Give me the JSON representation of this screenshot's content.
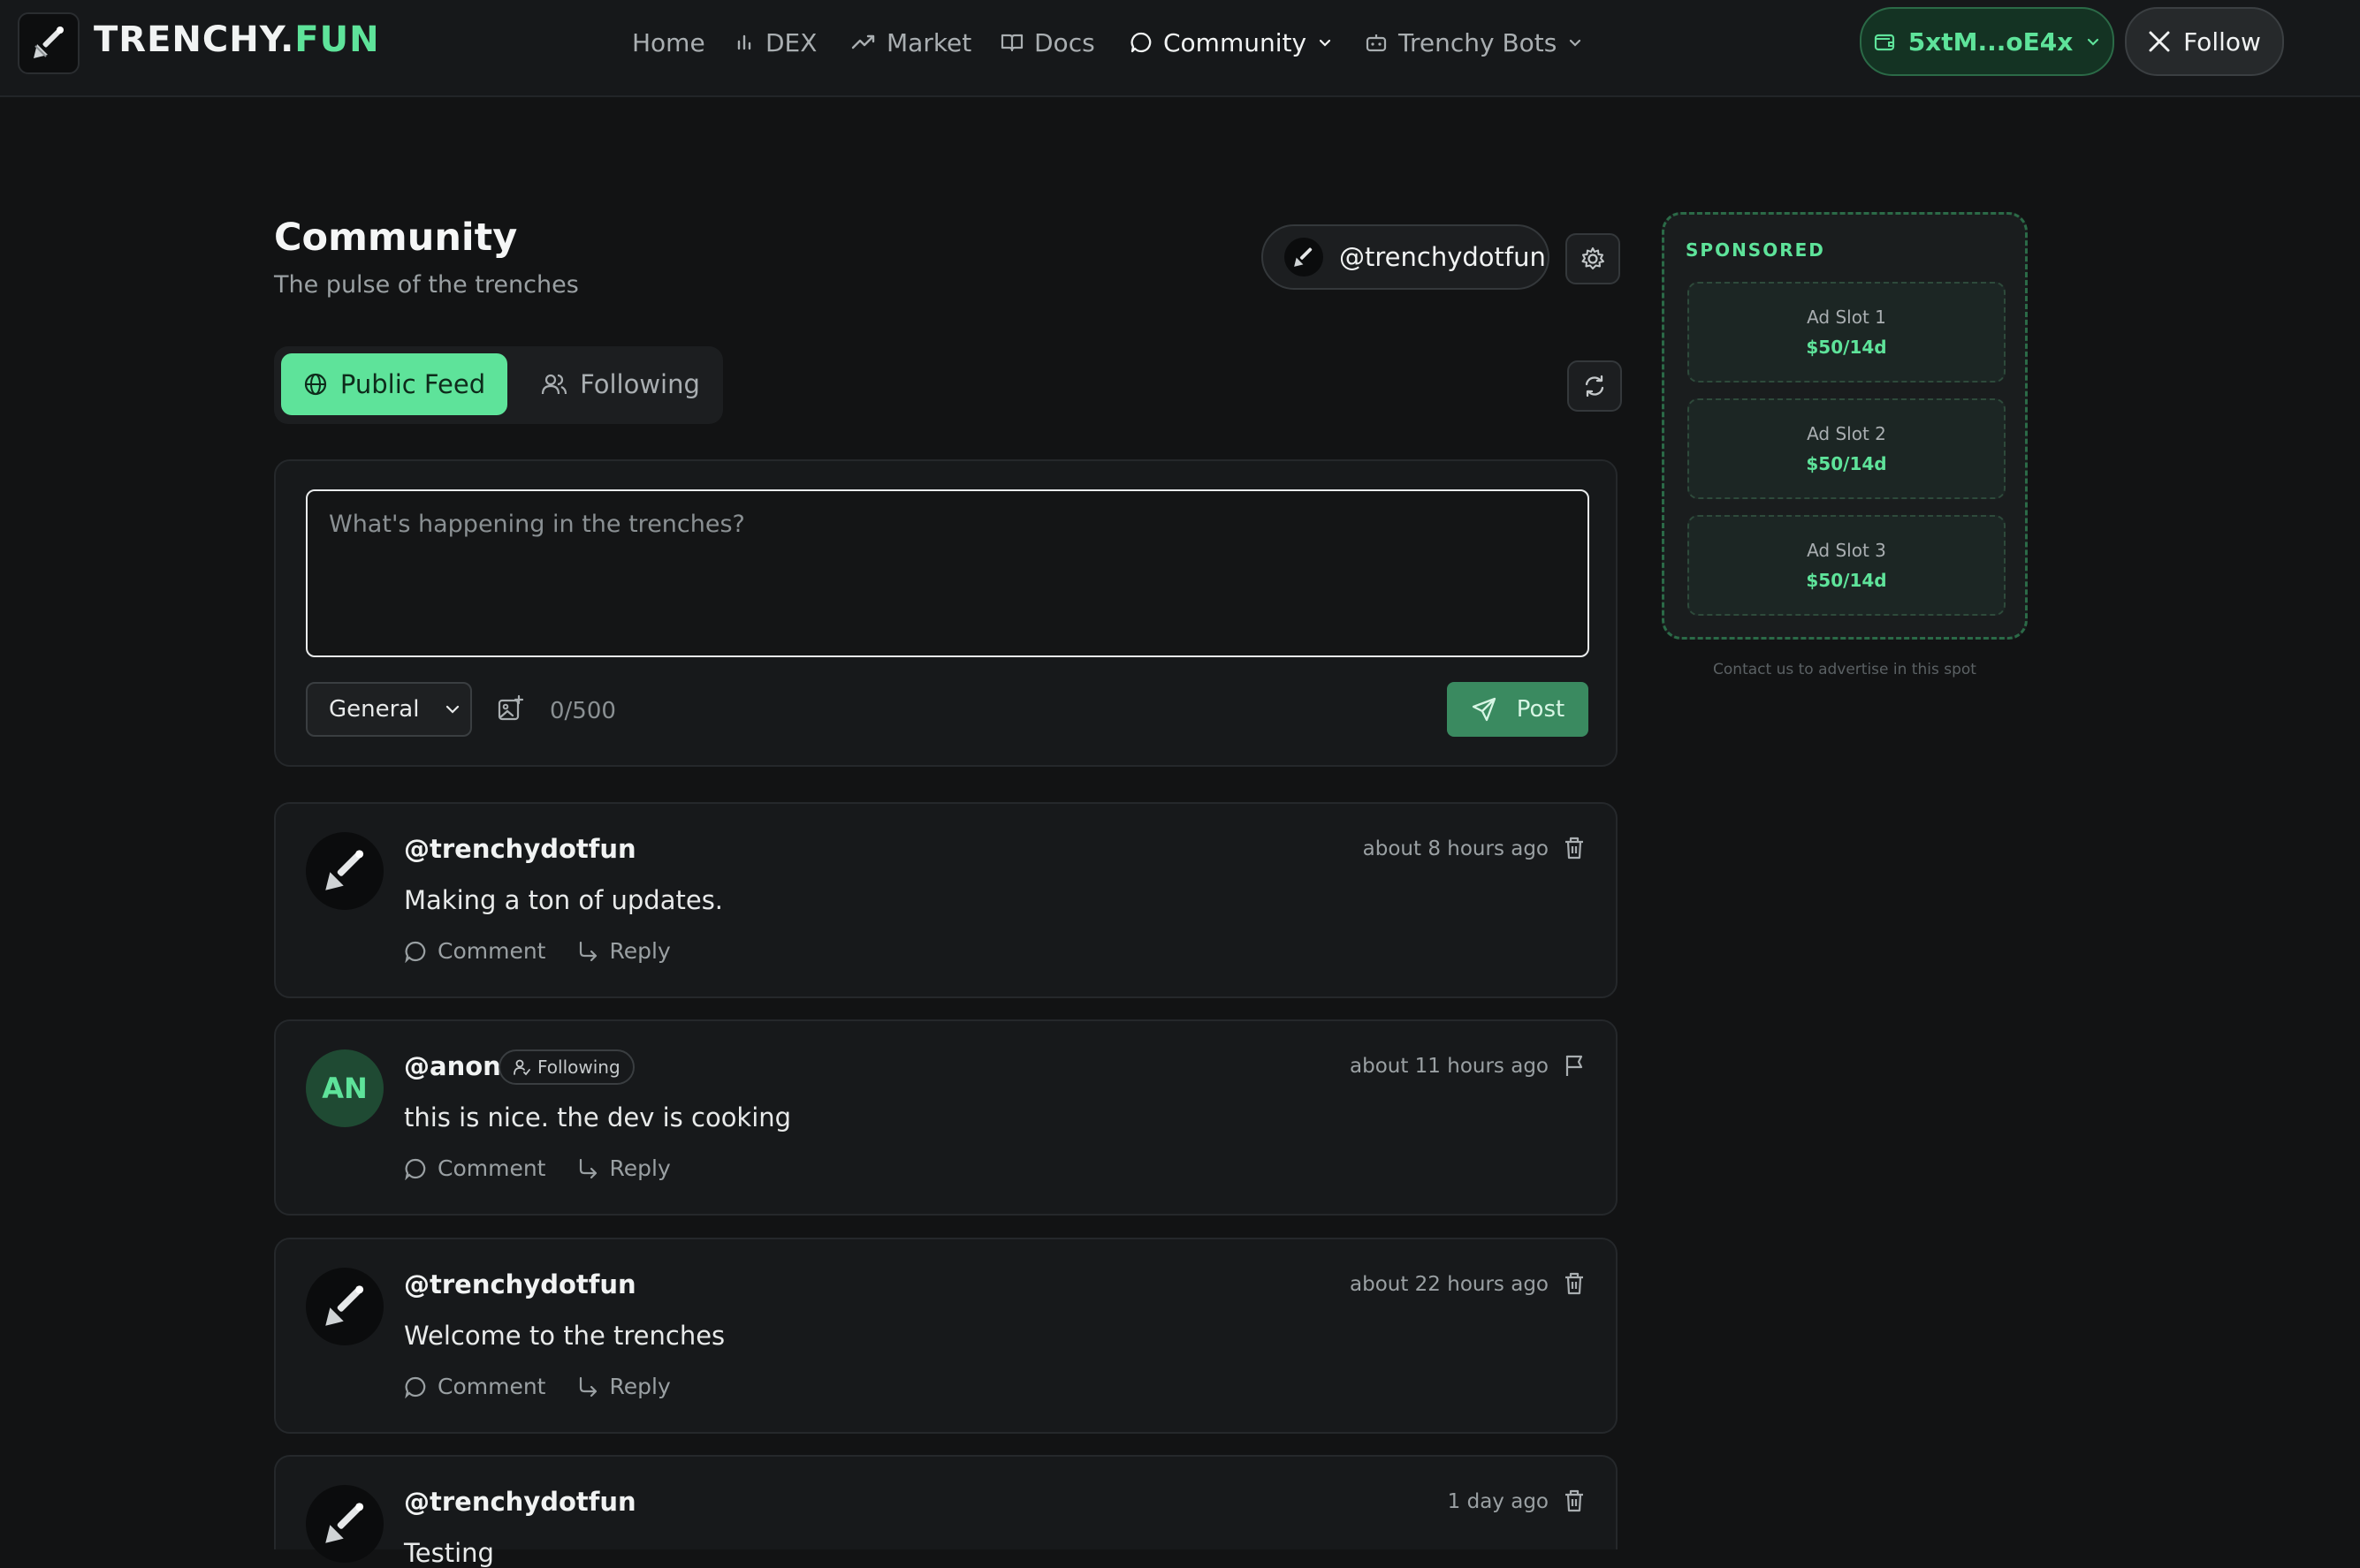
{
  "nav": {
    "brand_main": "TRENCHY.",
    "brand_accent": "FUN",
    "items": [
      {
        "label": "Home"
      },
      {
        "label": "DEX"
      },
      {
        "label": "Market"
      },
      {
        "label": "Docs"
      },
      {
        "label": "Community"
      },
      {
        "label": "Trenchy Bots"
      }
    ],
    "wallet": "5xtM...oE4x",
    "follow": "Follow"
  },
  "header": {
    "title": "Community",
    "subtitle": "The pulse of the trenches",
    "handle": "@trenchydotfun"
  },
  "tabs": [
    {
      "label": "Public Feed"
    },
    {
      "label": "Following"
    }
  ],
  "composer": {
    "placeholder": "What's happening in the trenches?",
    "category": "General",
    "counter": "0/500",
    "post_label": "Post"
  },
  "posts": [
    {
      "user": "@trenchydotfun",
      "time": "about 8 hours ago",
      "body": "Making a ton of updates.",
      "comment": "Comment",
      "reply": "Reply"
    },
    {
      "user": "@anon",
      "initials": "AN",
      "badge": "Following",
      "time": "about 11 hours ago",
      "body": "this is nice. the dev is cooking",
      "comment": "Comment",
      "reply": "Reply"
    },
    {
      "user": "@trenchydotfun",
      "time": "about 22 hours ago",
      "body": "Welcome to the trenches",
      "comment": "Comment",
      "reply": "Reply"
    },
    {
      "user": "@trenchydotfun",
      "time": "1 day ago",
      "body": "Testing"
    }
  ],
  "sponsored": {
    "title": "SPONSORED",
    "slots": [
      {
        "name": "Ad Slot 1",
        "price": "$50/14d"
      },
      {
        "name": "Ad Slot 2",
        "price": "$50/14d"
      },
      {
        "name": "Ad Slot 3",
        "price": "$50/14d"
      }
    ],
    "note": "Contact us to advertise in this spot"
  },
  "colors": {
    "accent": "#5ee39a",
    "background": "#121314",
    "card": "#17191b"
  }
}
